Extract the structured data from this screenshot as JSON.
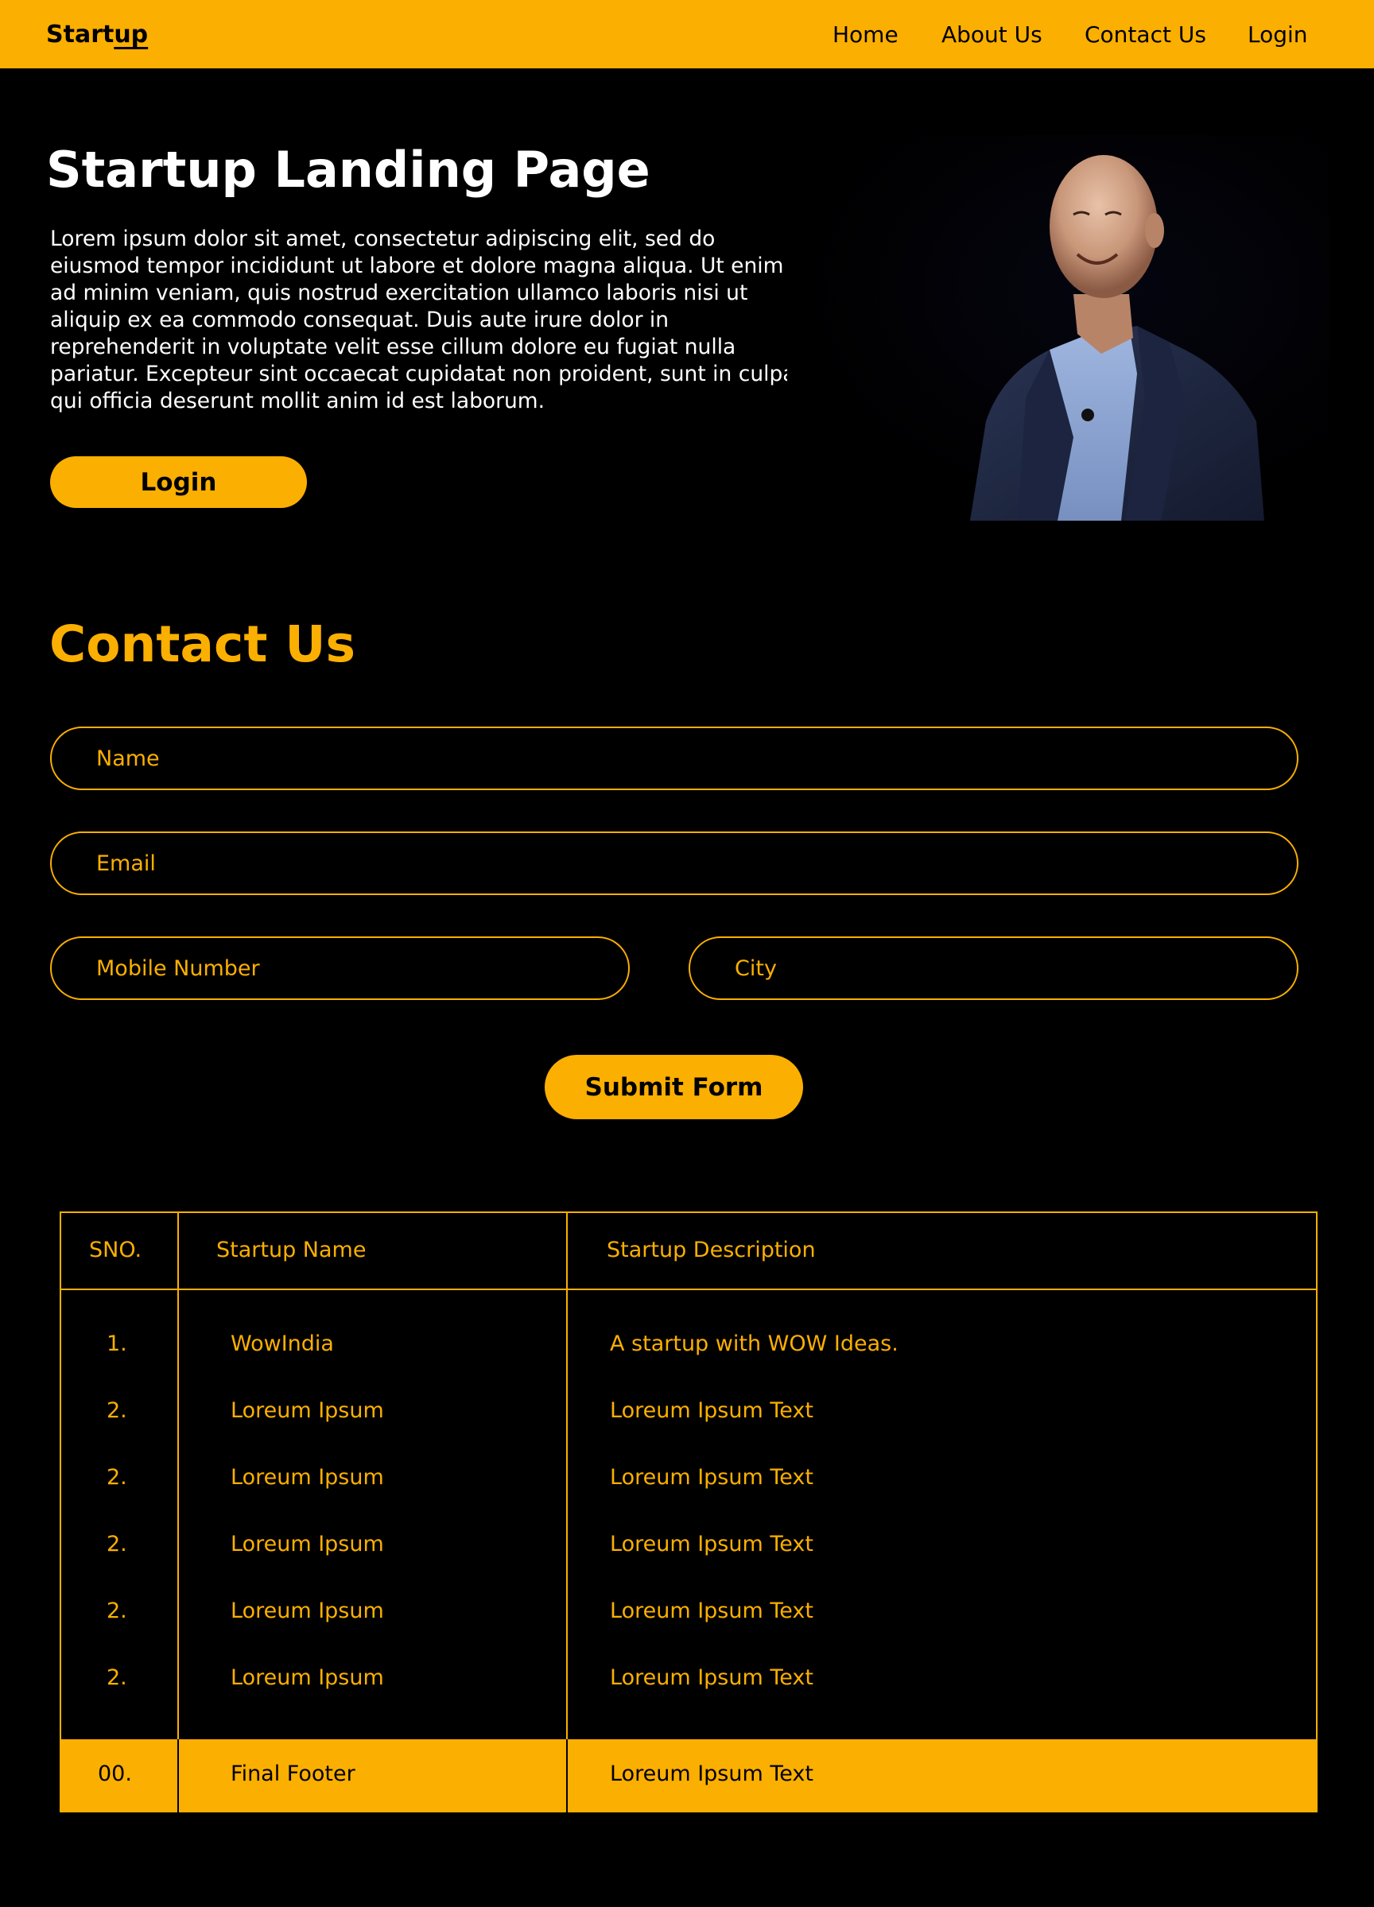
{
  "navbar": {
    "brand_prefix": "Start",
    "brand_suffix": "up",
    "links": [
      "Home",
      "About Us",
      "Contact Us",
      "Login"
    ]
  },
  "hero": {
    "title": "Startup Landing Page",
    "text": "Lorem ipsum dolor sit amet, consectetur adipiscing elit, sed do eiusmod tempor incididunt ut labore et dolore magna aliqua. Ut enim ad minim veniam, quis nostrud exercitation ullamco laboris nisi ut aliquip ex ea commodo consequat. Duis aute irure dolor in reprehenderit in voluptate velit esse cillum dolore eu fugiat nulla pariatur. Excepteur sint occaecat cupidatat non proident, sunt in culpa qui officia deserunt mollit anim id est laborum.",
    "login_label": "Login"
  },
  "contact": {
    "title": "Contact Us",
    "fields": {
      "name_placeholder": "Name",
      "email_placeholder": "Email",
      "mobile_placeholder": "Mobile Number",
      "city_placeholder": "City"
    },
    "submit_label": "Submit Form"
  },
  "table": {
    "headers": [
      "SNO.",
      "Startup Name",
      "Startup Description"
    ],
    "rows": [
      [
        "1.",
        "WowIndia",
        "A startup with WOW Ideas."
      ],
      [
        "2.",
        "Loreum Ipsum",
        "Loreum Ipsum Text"
      ],
      [
        "2.",
        "Loreum Ipsum",
        "Loreum Ipsum Text"
      ],
      [
        "2.",
        "Loreum Ipsum",
        "Loreum Ipsum Text"
      ],
      [
        "2.",
        "Loreum Ipsum",
        "Loreum Ipsum Text"
      ],
      [
        "2.",
        "Loreum Ipsum",
        "Loreum Ipsum Text"
      ]
    ],
    "footer": [
      "00.",
      "Final Footer",
      "Loreum Ipsum Text"
    ]
  },
  "colors": {
    "accent": "#FBAF01",
    "background": "#000000",
    "text_light": "#FFFFFF"
  }
}
